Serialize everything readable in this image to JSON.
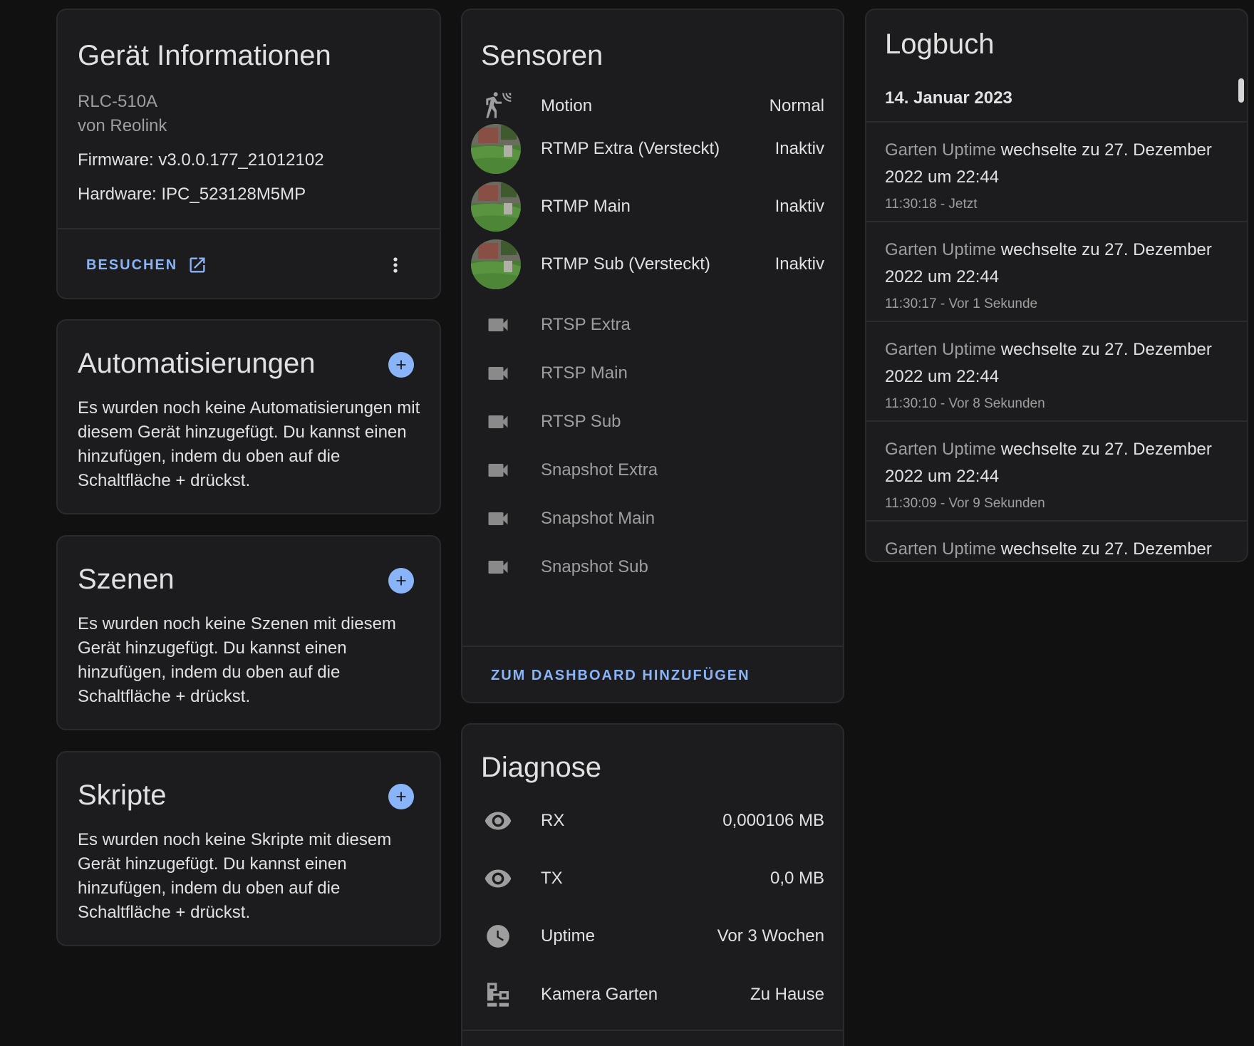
{
  "device_info": {
    "title": "Gerät Informationen",
    "model": "RLC-510A",
    "manufacturer": "von Reolink",
    "firmware": "Firmware: v3.0.0.177_21012102",
    "hardware": "Hardware: IPC_523128M5MP",
    "visit_label": "BESUCHEN"
  },
  "automations": {
    "title": "Automatisierungen",
    "text": "Es wurden noch keine Automatisierungen mit diesem Gerät hinzugefügt. Du kannst einen hinzufügen, indem du oben auf die Schaltfläche + drückst."
  },
  "scenes": {
    "title": "Szenen",
    "text": "Es wurden noch keine Szenen mit diesem Gerät hinzugefügt. Du kannst einen hinzufügen, indem du oben auf die Schaltfläche + drückst."
  },
  "scripts": {
    "title": "Skripte",
    "text": "Es wurden noch keine Skripte mit diesem Gerät hinzugefügt. Du kannst einen hinzufügen, indem du oben auf die Schaltfläche + drückst."
  },
  "sensors": {
    "title": "Sensoren",
    "items": [
      {
        "label": "Motion",
        "state": "Normal",
        "icon": "motion-sensor-icon"
      },
      {
        "label": "RTMP Extra (Versteckt)",
        "state": "Inaktiv",
        "icon": "camera-thumbnail"
      },
      {
        "label": "RTMP Main",
        "state": "Inaktiv",
        "icon": "camera-thumbnail"
      },
      {
        "label": "RTMP Sub (Versteckt)",
        "state": "Inaktiv",
        "icon": "camera-thumbnail"
      },
      {
        "label": "RTSP Extra",
        "state": "",
        "icon": "video-camera-icon"
      },
      {
        "label": "RTSP Main",
        "state": "",
        "icon": "video-camera-icon"
      },
      {
        "label": "RTSP Sub",
        "state": "",
        "icon": "video-camera-icon"
      },
      {
        "label": "Snapshot Extra",
        "state": "",
        "icon": "video-camera-icon"
      },
      {
        "label": "Snapshot Main",
        "state": "",
        "icon": "video-camera-icon"
      },
      {
        "label": "Snapshot Sub",
        "state": "",
        "icon": "video-camera-icon"
      }
    ],
    "add_dashboard_label": "ZUM DASHBOARD HINZUFÜGEN"
  },
  "diagnostics": {
    "title": "Diagnose",
    "items": [
      {
        "label": "RX",
        "state": "0,000106 MB",
        "icon": "eye-icon"
      },
      {
        "label": "TX",
        "state": "0,0 MB",
        "icon": "eye-icon"
      },
      {
        "label": "Uptime",
        "state": "Vor 3 Wochen",
        "icon": "clock-icon"
      },
      {
        "label": "Kamera Garten",
        "state": "Zu Hause",
        "icon": "network-icon"
      }
    ]
  },
  "logbook": {
    "title": "Logbuch",
    "date": "14. Januar 2023",
    "entries": [
      {
        "entity": "Garten Uptime",
        "message": "wechselte zu 27. Dezember",
        "message2": "2022 um 22:44",
        "time": "11:30:18 - Jetzt"
      },
      {
        "entity": "Garten Uptime",
        "message": "wechselte zu 27. Dezember",
        "message2": "2022 um 22:44",
        "time": "11:30:17 - Vor 1 Sekunde"
      },
      {
        "entity": "Garten Uptime",
        "message": "wechselte zu 27. Dezember",
        "message2": "2022 um 22:44",
        "time": "11:30:10 - Vor 8 Sekunden"
      },
      {
        "entity": "Garten Uptime",
        "message": "wechselte zu 27. Dezember",
        "message2": "2022 um 22:44",
        "time": "11:30:09 - Vor 9 Sekunden"
      },
      {
        "entity": "Garten Uptime",
        "message": "wechselte zu 27. Dezember",
        "message2": "",
        "time": ""
      }
    ]
  },
  "colors": {
    "background": "#111111",
    "card": "#1c1c1e",
    "accent": "#8ab4f8",
    "text": "#e1e1e1",
    "muted": "#9e9e9e"
  }
}
